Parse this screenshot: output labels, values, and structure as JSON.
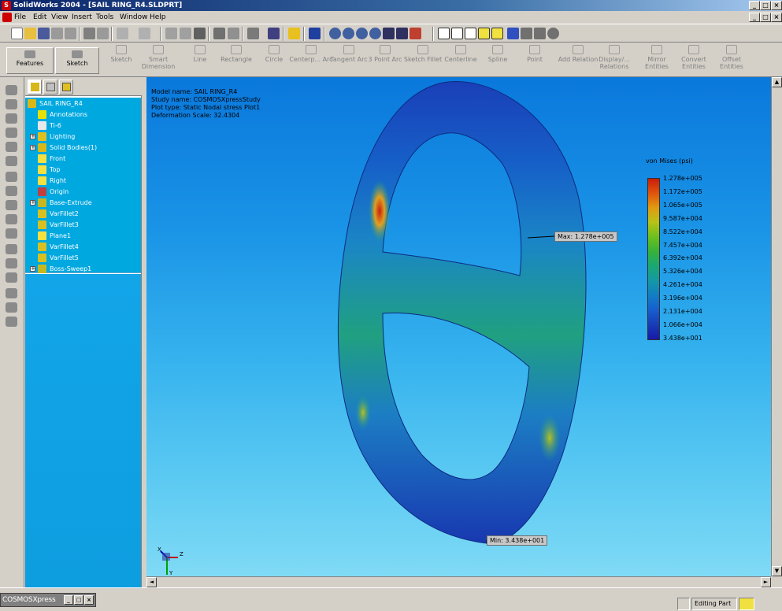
{
  "window": {
    "title": "SolidWorks 2004 - [SAIL RING_R4.SLDPRT]",
    "controls": [
      "_",
      "□",
      "×"
    ],
    "doc_controls": [
      "_",
      "□",
      "×"
    ]
  },
  "menu": [
    "File",
    "Edit",
    "View",
    "Insert",
    "Tools",
    "Window",
    "Help"
  ],
  "command_manager": {
    "tabs": [
      {
        "label": "Features",
        "icon": "features-icon"
      },
      {
        "label": "Sketch",
        "icon": "sketch-grid-icon"
      }
    ],
    "commands": [
      {
        "label": "Sketch",
        "icon": "sketch-icon",
        "active": false
      },
      {
        "label": "Smart Dimension",
        "icon": "smart-dimension-icon",
        "active": false
      },
      {
        "label": "Line",
        "icon": "line-icon",
        "active": false
      },
      {
        "label": "Rectangle",
        "icon": "rectangle-icon",
        "active": false
      },
      {
        "label": "Circle",
        "icon": "circle-icon",
        "active": false
      },
      {
        "label": "Centerp... Arc",
        "icon": "centerpoint-arc-icon",
        "active": false
      },
      {
        "label": "Tangent Arc",
        "icon": "tangent-arc-icon",
        "active": false
      },
      {
        "label": "3 Point Arc",
        "icon": "three-point-arc-icon",
        "active": false
      },
      {
        "label": "Sketch Fillet",
        "icon": "sketch-fillet-icon",
        "active": false
      },
      {
        "label": "Centerline",
        "icon": "centerline-icon",
        "active": false
      },
      {
        "label": "Spline",
        "icon": "spline-icon",
        "active": false
      },
      {
        "label": "Point",
        "icon": "point-icon",
        "active": false
      },
      {
        "label": "Add Relation",
        "icon": "add-relation-icon",
        "active": false
      },
      {
        "label": "Display/... Relations",
        "icon": "display-relations-icon",
        "active": false
      },
      {
        "label": "Mirror Entities",
        "icon": "mirror-entities-icon",
        "active": false
      },
      {
        "label": "Convert Entities",
        "icon": "convert-entities-icon",
        "active": false
      },
      {
        "label": "Offset Entities",
        "icon": "offset-entities-icon",
        "active": false
      }
    ]
  },
  "feature_tree": {
    "root": "SAIL RING_R4",
    "items": [
      {
        "label": "Annotations",
        "icon": "annotations-icon",
        "color": "#e8e000",
        "expandable": false
      },
      {
        "label": "Ti-6",
        "icon": "material-icon",
        "color": "#e8e8e8",
        "expandable": false
      },
      {
        "label": "Lighting",
        "icon": "lighting-icon",
        "color": "#e0c020",
        "expandable": true
      },
      {
        "label": "Solid Bodies(1)",
        "icon": "solid-bodies-icon",
        "color": "#d8b818",
        "expandable": true
      },
      {
        "label": "Front",
        "icon": "plane-icon",
        "color": "#f4e040",
        "expandable": false
      },
      {
        "label": "Top",
        "icon": "plane-icon",
        "color": "#f4e040",
        "expandable": false
      },
      {
        "label": "Right",
        "icon": "plane-icon",
        "color": "#f4e040",
        "expandable": false
      },
      {
        "label": "Origin",
        "icon": "origin-icon",
        "color": "#c04040",
        "expandable": false
      },
      {
        "label": "Base-Extrude",
        "icon": "extrude-icon",
        "color": "#c8b820",
        "expandable": true
      },
      {
        "label": "VarFillet2",
        "icon": "fillet-icon",
        "color": "#d8c020",
        "expandable": false
      },
      {
        "label": "VarFillet3",
        "icon": "fillet-icon",
        "color": "#d8c020",
        "expandable": false
      },
      {
        "label": "Plane1",
        "icon": "plane-icon",
        "color": "#f4e040",
        "expandable": false
      },
      {
        "label": "VarFillet4",
        "icon": "fillet-icon",
        "color": "#d8c020",
        "expandable": false
      },
      {
        "label": "VarFillet5",
        "icon": "fillet-icon",
        "color": "#d8c020",
        "expandable": false
      },
      {
        "label": "Boss-Sweep1",
        "icon": "sweep-icon",
        "color": "#c8b820",
        "expandable": true
      }
    ]
  },
  "viewport": {
    "info_lines": [
      "Model name: SAIL RING_R4",
      "Study name: COSMOSXpressStudy",
      "Plot type: Static Nodal stress Plot1",
      "Deformation Scale: 32.4304"
    ],
    "max_marker": "Max: 1.278e+005",
    "min_marker": "Min: 3.438e+001",
    "triad": {
      "x": "X",
      "y": "Y",
      "z": "Z"
    }
  },
  "legend": {
    "title": "von Mises (psi)",
    "labels": [
      "1.278e+005",
      "1.172e+005",
      "1.065e+005",
      "9.587e+004",
      "8.522e+004",
      "7.457e+004",
      "6.392e+004",
      "5.326e+004",
      "4.261e+004",
      "3.196e+004",
      "2.131e+004",
      "1.066e+004",
      "3.438e+001"
    ]
  },
  "statusbar": {
    "cosmos_label": "COSMOSXpress",
    "mode": "Editing Part"
  }
}
